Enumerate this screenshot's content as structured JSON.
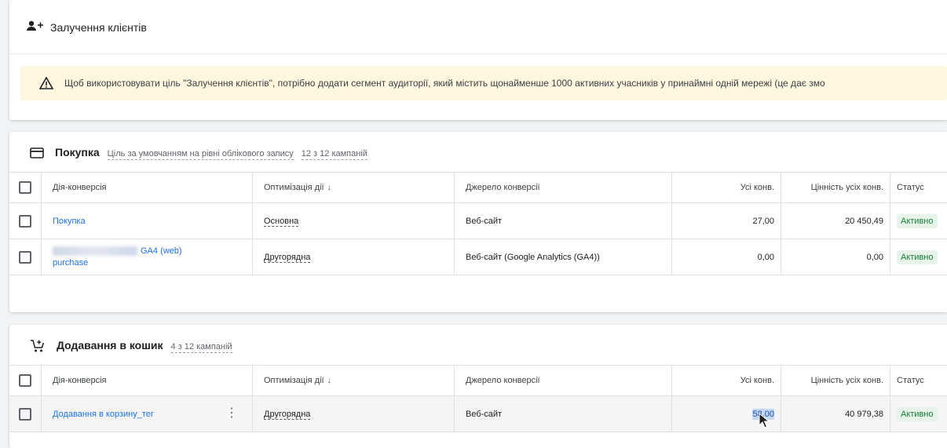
{
  "acquisition": {
    "title": "Залучення клієнтів",
    "warning": "Щоб використовувати ціль \"Залучення клієнтів\", потрібно додати сегмент аудиторії, який містить щонайменше 1000 активних учасників у принаймні одній мережі (це дає змо"
  },
  "purchase": {
    "title": "Покупка",
    "subtitle": "Ціль за умовчанням на рівні облікового запису",
    "campaigns": "12 з 12 кампаній",
    "headers": {
      "action": "Дія-конверсія",
      "optimization": "Оптимізація дії",
      "source": "Джерело конверсії",
      "all_conv": "Усі конв.",
      "value": "Цінність усіх конв.",
      "status": "Статус"
    },
    "rows": [
      {
        "action": "Покупка",
        "optimization": "Основна",
        "source": "Веб-сайт",
        "all_conv": "27,00",
        "value": "20 450,49",
        "status": "Активно"
      },
      {
        "action_line1": "GA4 (web)",
        "action_line2": "purchase",
        "optimization": "Другорядна",
        "source": "Веб-сайт (Google Analytics (GA4))",
        "all_conv": "0,00",
        "value": "0,00",
        "status": "Активно"
      }
    ]
  },
  "cart": {
    "title": "Додавання в кошик",
    "campaigns": "4 з 12 кампаній",
    "headers": {
      "action": "Дія-конверсія",
      "optimization": "Оптимізація дії",
      "source": "Джерело конверсії",
      "all_conv": "Усі конв.",
      "value": "Цінність усіх конв.",
      "status": "Статус"
    },
    "rows": [
      {
        "action": "Додавання в корзину_тег",
        "optimization": "Другорядна",
        "source": "Веб-сайт",
        "all_conv": "58,00",
        "value": "40 979,38",
        "status": "Активно"
      }
    ]
  },
  "icons": {
    "acquisition": "person-add-icon",
    "warning": "warning-icon",
    "purchase": "card-icon",
    "cart": "cart-add-icon",
    "sort": "arrow-down-icon",
    "more": "kebab-icon"
  },
  "colors": {
    "link": "#1a73e8",
    "active_bg": "#e6f4ea",
    "active_text": "#188038",
    "warning_bg": "#fef7e0"
  }
}
